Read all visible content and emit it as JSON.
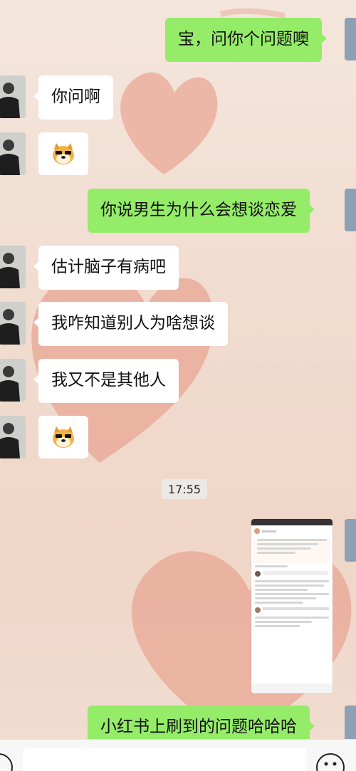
{
  "chat": {
    "messages": [
      {
        "side": "right",
        "text": "宝，问你个问题噢"
      },
      {
        "side": "left",
        "text": "你问啊"
      },
      {
        "side": "left",
        "sticker": "doge-sticker"
      },
      {
        "side": "right",
        "text": "你说男生为什么会想谈恋爱"
      },
      {
        "side": "left",
        "text": "估计脑子有病吧"
      },
      {
        "side": "left",
        "text": "我咋知道别人为啥想谈"
      },
      {
        "side": "left",
        "text": "我又不是其他人"
      },
      {
        "side": "left",
        "sticker": "doge-sticker"
      },
      {
        "side": "center",
        "time": "17:55"
      },
      {
        "side": "right",
        "image": "screenshot-thumbnail"
      },
      {
        "side": "right",
        "text": "小红书上刷到的问题哈哈哈"
      }
    ]
  },
  "colors": {
    "sent_bubble": "#95ec69",
    "received_bubble": "#ffffff",
    "wallpaper_heart": "#e8a392"
  },
  "input_bar": {
    "left_icon": "voice-icon",
    "right_icon": "emoji-icon"
  }
}
